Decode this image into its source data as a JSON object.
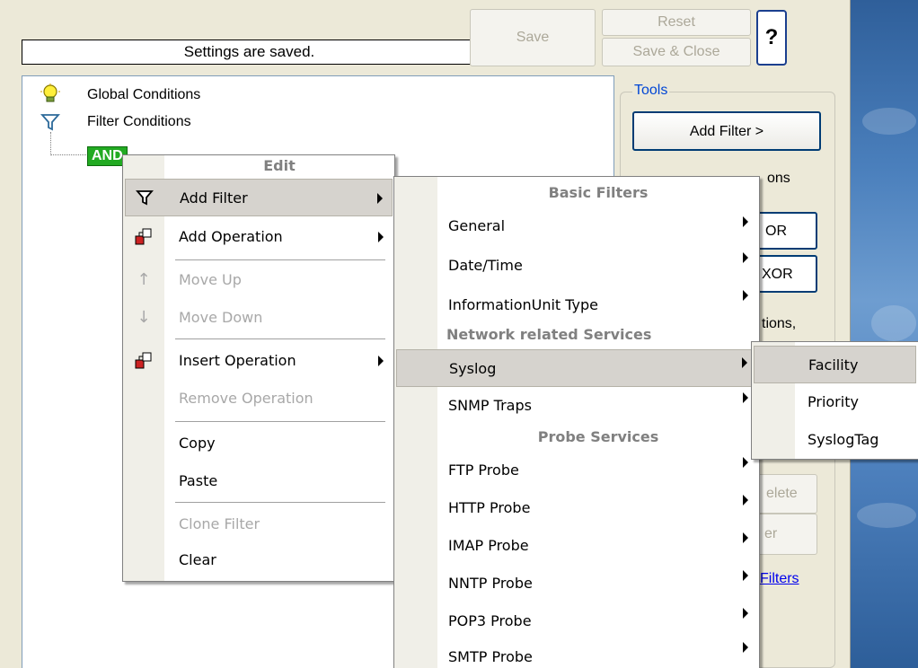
{
  "status": {
    "text": "Settings are saved."
  },
  "buttons": {
    "save": "Save",
    "reset": "Reset",
    "save_close": "Save & Close",
    "help": "?"
  },
  "tree": {
    "global_conditions": "Global Conditions",
    "filter_conditions": "Filter Conditions",
    "and_node": "AND"
  },
  "tools": {
    "label": "Tools",
    "add_filter": "Add Filter >",
    "partial_conditions": "ons",
    "partial_or": "OR",
    "partial_xor": "XOR",
    "partial_tions": "tions,",
    "partial_delete": "elete",
    "partial_er": "er",
    "filters_link": "Filters"
  },
  "context_menu": {
    "header": "Edit",
    "items": [
      {
        "label": "Add Filter",
        "icon": "funnel-icon",
        "submenu": true,
        "highlighted": true
      },
      {
        "label": "Add Operation",
        "icon": "operation-icon",
        "submenu": true
      },
      {
        "label": "Move Up",
        "icon": "arrow-up-icon",
        "disabled": true
      },
      {
        "label": "Move Down",
        "icon": "arrow-down-icon",
        "disabled": true
      },
      {
        "label": "Insert Operation",
        "icon": "operation-icon",
        "submenu": true
      },
      {
        "label": "Remove Operation",
        "disabled": true
      },
      {
        "label": "Copy"
      },
      {
        "label": "Paste"
      },
      {
        "label": "Clone Filter",
        "disabled": true
      },
      {
        "label": "Clear"
      }
    ]
  },
  "filter_submenu": {
    "header_basic": "Basic Filters",
    "basic": [
      "General",
      "Date/Time",
      "InformationUnit Type"
    ],
    "header_network": "Network related Services",
    "network": [
      "Syslog",
      "SNMP Traps"
    ],
    "header_probe": "Probe Services",
    "probe": [
      "FTP Probe",
      "HTTP Probe",
      "IMAP Probe",
      "NNTP Probe",
      "POP3 Probe",
      "SMTP Probe"
    ]
  },
  "syslog_submenu": {
    "items": [
      "Facility",
      "Priority",
      "SyslogTag"
    ]
  },
  "colors": {
    "accent": "#0046d5",
    "and_node": "#22aa22",
    "menu_highlight": "#d6d3ce"
  }
}
